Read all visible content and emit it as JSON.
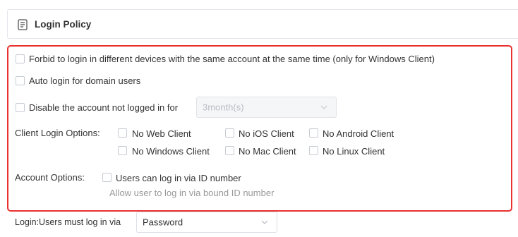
{
  "section": {
    "title": "Login Policy",
    "icon": "document-list-icon"
  },
  "options": {
    "forbid_multi_device": "Forbid to login in different devices with the same account at the same time (only for Windows Client)",
    "auto_login_domain": "Auto login for domain users",
    "disable_inactive": "Disable the account not logged in for",
    "disable_period_value": "3month(s)"
  },
  "client_login": {
    "label": "Client Login Options:",
    "items": [
      "No Web Client",
      "No iOS Client",
      "No Android Client",
      "No Windows Client",
      "No Mac Client",
      "No Linux Client"
    ]
  },
  "account_options": {
    "label": "Account Options:",
    "id_login": "Users can log in via ID number",
    "id_login_hint": "Allow user to log in via bound ID number"
  },
  "login_method": {
    "label": "Login:Users must log in via",
    "value": "Password"
  },
  "colors": {
    "highlight_frame": "#e8312f",
    "border": "#dcdfe6",
    "text": "#333333",
    "muted": "#999999"
  }
}
